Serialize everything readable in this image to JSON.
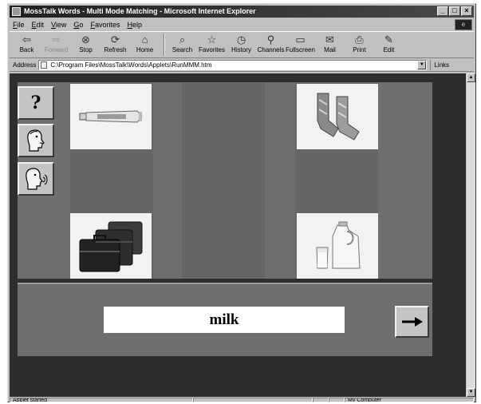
{
  "window": {
    "title": "MossTalk Words - Multi Mode Matching - Microsoft Internet Explorer",
    "controls": [
      "_",
      "□",
      "×"
    ]
  },
  "menu": [
    "File",
    "Edit",
    "View",
    "Go",
    "Favorites",
    "Help"
  ],
  "toolbar": [
    {
      "label": "Back",
      "icon": "back-arrow-icon",
      "glyph": "⇦",
      "enabled": true
    },
    {
      "label": "Forward",
      "icon": "forward-arrow-icon",
      "glyph": "⇨",
      "enabled": false
    },
    {
      "label": "Stop",
      "icon": "stop-icon",
      "glyph": "⊗",
      "enabled": true
    },
    {
      "label": "Refresh",
      "icon": "refresh-icon",
      "glyph": "⟳",
      "enabled": true
    },
    {
      "label": "Home",
      "icon": "home-icon",
      "glyph": "⌂",
      "enabled": true
    },
    {
      "label": "Search",
      "icon": "search-icon",
      "glyph": "⌕",
      "enabled": true
    },
    {
      "label": "Favorites",
      "icon": "favorites-icon",
      "glyph": "☆",
      "enabled": true
    },
    {
      "label": "History",
      "icon": "history-icon",
      "glyph": "◷",
      "enabled": true
    },
    {
      "label": "Channels",
      "icon": "channels-icon",
      "glyph": "⚲",
      "enabled": true
    },
    {
      "label": "Fullscreen",
      "icon": "fullscreen-icon",
      "glyph": "▭",
      "enabled": true
    },
    {
      "label": "Mail",
      "icon": "mail-icon",
      "glyph": "✉",
      "enabled": true
    },
    {
      "label": "Print",
      "icon": "print-icon",
      "glyph": "⎙",
      "enabled": true
    },
    {
      "label": "Edit",
      "icon": "edit-icon",
      "glyph": "✎",
      "enabled": true
    }
  ],
  "address": {
    "label": "Address",
    "value": "C:\\Program Files\\MossTalk\\Words\\Applets\\RunMMM.htm",
    "links_label": "Links"
  },
  "applet": {
    "help_button": "?",
    "side_buttons": [
      "speak-icon",
      "repeat-speak-icon"
    ],
    "pictures": [
      "toothpaste",
      "socks",
      "suitcases",
      "milk"
    ],
    "target_word": "milk",
    "next_button_icon": "right-arrow-icon"
  },
  "status": {
    "text": "Applet started",
    "zone": "My Computer"
  }
}
